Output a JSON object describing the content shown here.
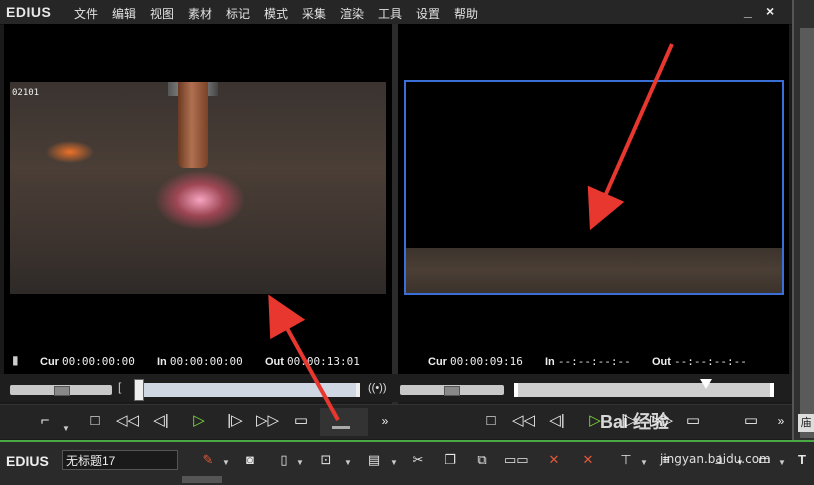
{
  "app": {
    "name": "EDIUS"
  },
  "menu": [
    "文件",
    "编辑",
    "视图",
    "素材",
    "标记",
    "模式",
    "采集",
    "渲染",
    "工具",
    "设置",
    "帮助"
  ],
  "window_buttons": {
    "minimize": "_",
    "close": "×"
  },
  "source_monitor": {
    "clip_label": "02101",
    "cur_label": "Cur",
    "cur_value": "00:00:00:00",
    "in_label": "In",
    "in_value": "00:00:00:00",
    "out_label": "Out",
    "out_value": "00:00:13:01"
  },
  "record_monitor": {
    "cur_label": "Cur",
    "cur_value": "00:00:09:16",
    "in_label": "In",
    "in_value": "--:--:--:--",
    "out_label": "Out",
    "out_value": "--:--:--:--"
  },
  "bottom_toolbar": {
    "logo": "EDIUS",
    "project_name": "无标题17"
  },
  "right_panel": {
    "tab_label": "庙"
  },
  "watermark": {
    "text": "Bai 经验",
    "url": "jingyan.baidu.com"
  },
  "colors": {
    "accent_green": "#4aa845",
    "play_green": "#7ddf3a",
    "selection_blue": "#3a6fd8",
    "arrow_red": "#e8372f"
  }
}
